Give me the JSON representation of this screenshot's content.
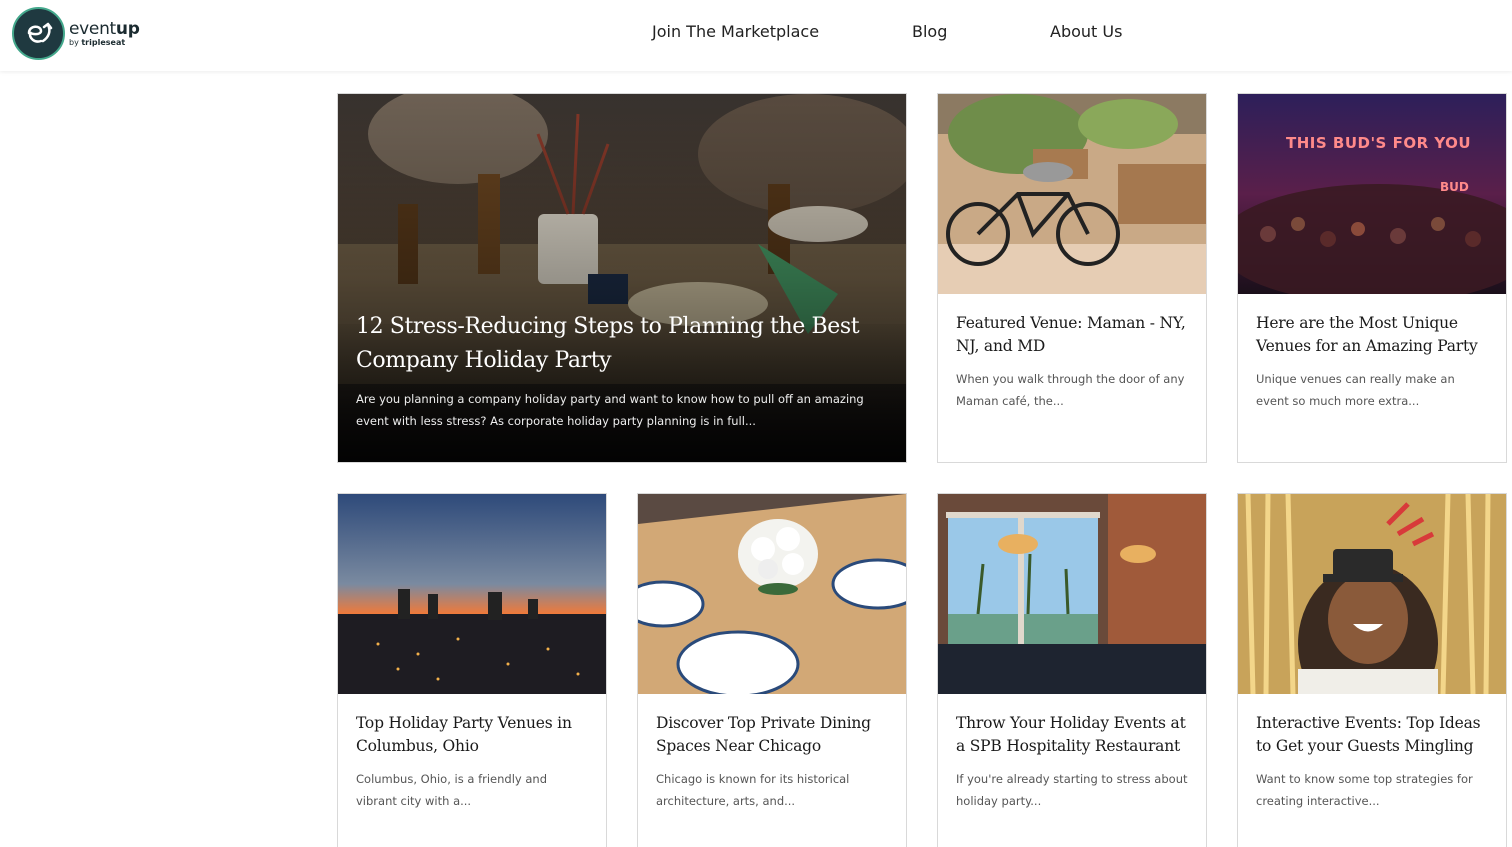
{
  "header": {
    "logo": {
      "word_light": "event",
      "word_bold": "up",
      "sub_light": "by ",
      "sub_bold": "tripleseat"
    },
    "nav": [
      "Join The Marketplace",
      "Blog",
      "About Us"
    ]
  },
  "featured": {
    "title": "12 Stress-Reducing Steps to Planning the Best Company Holiday Party",
    "excerpt": "Are you planning a company holiday party and want to know how to pull off an amazing event with less stress? As corporate holiday party planning is in full..."
  },
  "cards": [
    {
      "title": "Featured Venue: Maman - NY, NJ, and MD",
      "excerpt": "When you walk through the door of any Maman café, the..."
    },
    {
      "title": "Here are the Most Unique Venues for an Amazing Party",
      "excerpt": "Unique venues can really make an event so much more extra...",
      "image_text": "THIS BUD'S FOR YOU",
      "image_text_2": "BUD"
    },
    {
      "title": "Top Holiday Party Venues in Columbus, Ohio",
      "excerpt": "Columbus, Ohio, is a friendly and vibrant city with a..."
    },
    {
      "title": "Discover Top Private Dining Spaces Near Chicago",
      "excerpt": "Chicago is known for its historical architecture, arts, and..."
    },
    {
      "title": "Throw Your Holiday Events at a SPB Hospitality Restaurant",
      "excerpt": "If you're already starting to stress about holiday party..."
    },
    {
      "title": "Interactive Events: Top Ideas to Get your Guests Mingling",
      "excerpt": "Want to know some top strategies for creating interactive..."
    }
  ],
  "colors": {
    "brand_dark": "#1f3940",
    "brand_accent": "#44a88c"
  }
}
